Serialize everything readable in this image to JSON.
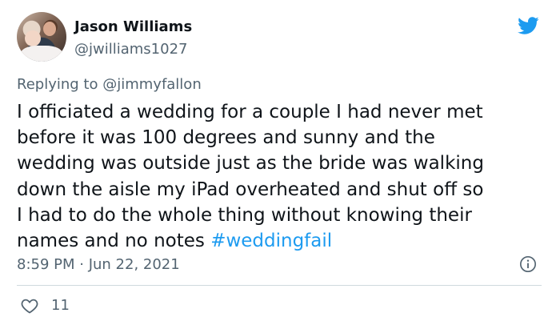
{
  "tweet": {
    "author": {
      "name": "Jason Williams",
      "handle": "@jwilliams1027",
      "avatar_icon": "profile-photo"
    },
    "brand_icon": "twitter-bird-icon",
    "brand_color": "#1d9bf0",
    "replying_prefix": "Replying to",
    "replying_to": "@jimmyfallon",
    "text": "I officiated a wedding for a couple I had never met\nbefore it was 100 degrees and sunny and the\nwedding was outside just as the bride was walking\ndown the aisle my iPad overheated and shut off so\nI had to do the whole thing without knowing their\nnames and  no notes ",
    "hashtag": "#weddingfail",
    "timestamp": "8:59 PM · Jun 22, 2021",
    "info_icon": "info-icon",
    "like_icon": "heart-icon",
    "like_count": "11"
  }
}
